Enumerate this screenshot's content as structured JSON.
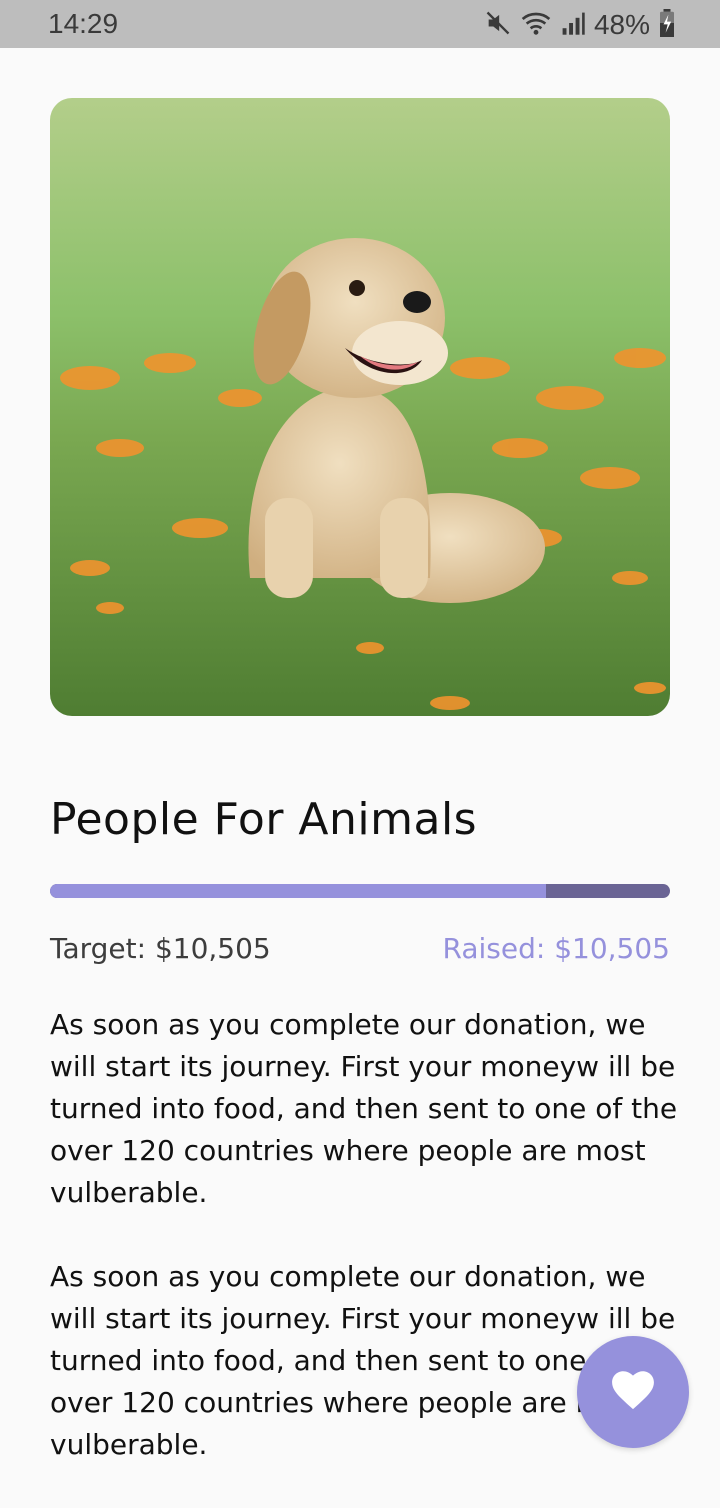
{
  "status_bar": {
    "time": "14:29",
    "battery": "48%",
    "icons": [
      "mute-icon",
      "wifi-icon",
      "signal-icon",
      "battery-charging-icon"
    ]
  },
  "hero_image": {
    "alt": "puppy-sitting-in-grass"
  },
  "campaign": {
    "title": "People For Animals",
    "progress_fraction": 0.8,
    "target_label": "Target: $10,505",
    "raised_label": "Raised: $10,505"
  },
  "description": {
    "paragraphs": [
      "As soon as you complete our donation, we will start its journey. First your moneyw ill be turned into food, and then sent to one of the over 120 countries where people are most vulberable.",
      "As soon as you complete our donation, we will start its journey. First your moneyw ill be turned into food, and then sent to one of the over 120 countries where people are most vulberable."
    ]
  },
  "fab": {
    "icon": "heart-icon"
  },
  "colors": {
    "accent": "#9591dc",
    "progress_track": "#6a6494",
    "status_bar": "#bdbdbd"
  }
}
